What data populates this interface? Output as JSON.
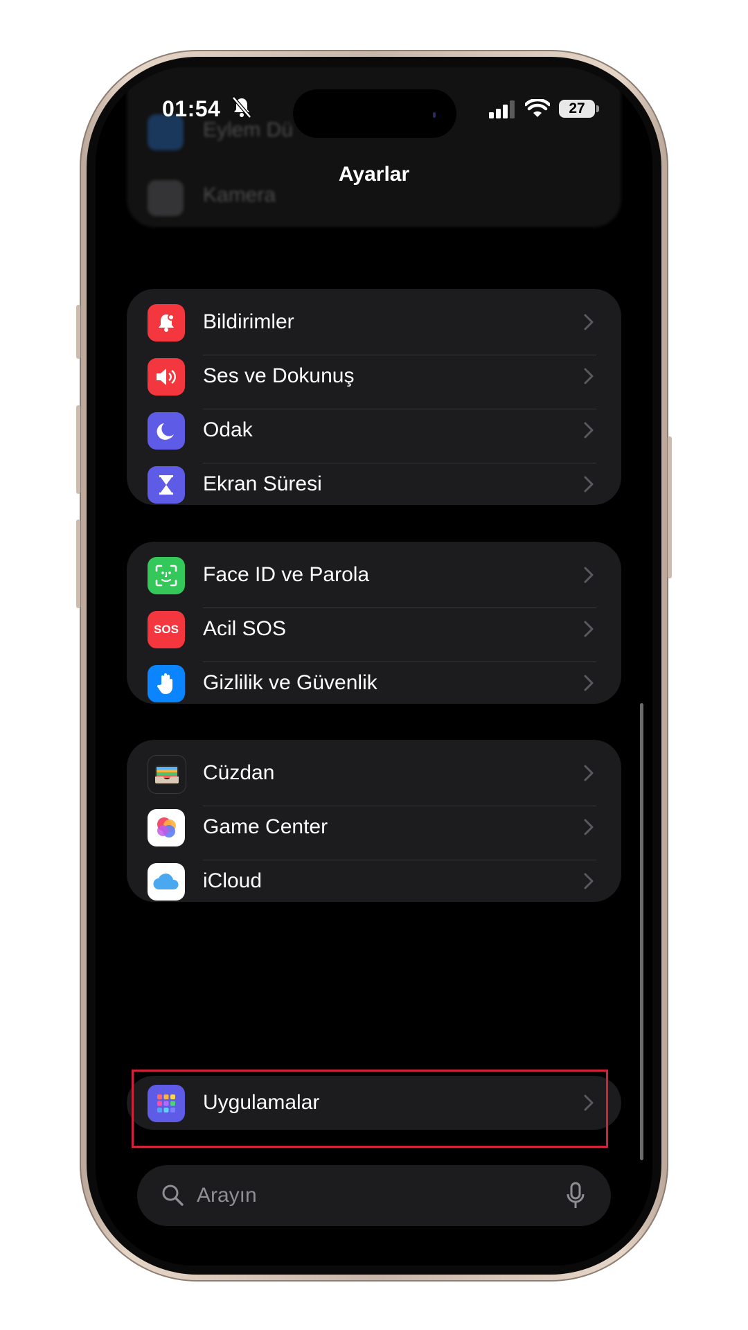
{
  "status_bar": {
    "time": "01:54",
    "battery": "27"
  },
  "nav": {
    "title": "Ayarlar"
  },
  "top_group_blurred": {
    "items": [
      "Eylem Dü",
      "Kamera"
    ]
  },
  "groups": [
    {
      "items": [
        {
          "label": "Bildirimler",
          "icon": "bell-icon",
          "color": "#f4363f"
        },
        {
          "label": "Ses ve Dokunuş",
          "icon": "speaker-icon",
          "color": "#f4363f"
        },
        {
          "label": "Odak",
          "icon": "moon-icon",
          "color": "#5e5ce6"
        },
        {
          "label": "Ekran Süresi",
          "icon": "hourglass-icon",
          "color": "#5e5ce6"
        }
      ]
    },
    {
      "items": [
        {
          "label": "Face ID ve Parola",
          "icon": "face-id-icon",
          "color": "#34c759"
        },
        {
          "label": "Acil SOS",
          "icon": "sos-icon",
          "icon_text": "SOS",
          "color": "#f4363f"
        },
        {
          "label": "Gizlilik ve Güvenlik",
          "icon": "hand-icon",
          "color": "#0a84ff"
        }
      ]
    },
    {
      "items": [
        {
          "label": "Cüzdan",
          "icon": "wallet-icon",
          "color": "#1c1c1e"
        },
        {
          "label": "Game Center",
          "icon": "game-center-icon",
          "color": "#ffffff"
        },
        {
          "label": "iCloud",
          "icon": "icloud-icon",
          "color": "#ffffff"
        }
      ]
    },
    {
      "items": [
        {
          "label": "Uygulamalar",
          "icon": "apps-grid-icon",
          "color": "#5e5ce6",
          "highlighted": true
        }
      ]
    }
  ],
  "search": {
    "placeholder": "Arayın"
  },
  "colors": {
    "highlight": "#d0223a",
    "group_bg": "#1c1c1e"
  }
}
